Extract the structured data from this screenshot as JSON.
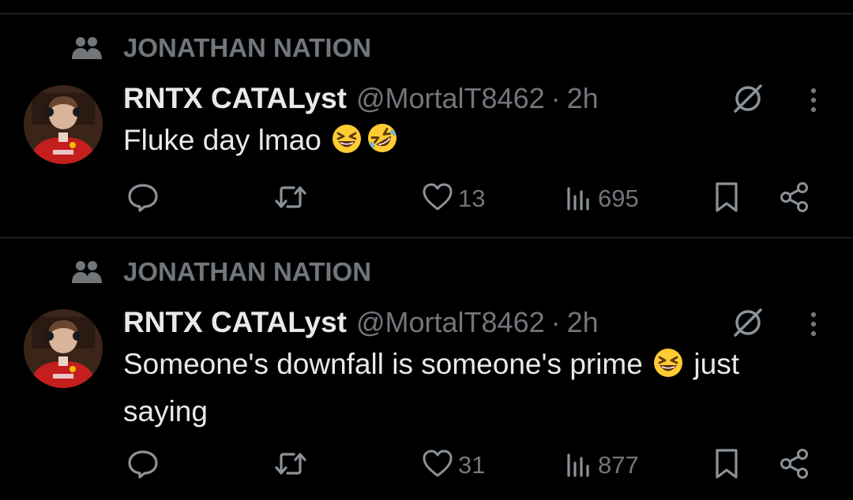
{
  "colors": {
    "background": "#000000",
    "text_primary": "#e7e9ea",
    "text_secondary": "#71767b",
    "divider": "#2f3336"
  },
  "tweets": [
    {
      "community": "JONATHAN NATION",
      "display_name": "RNTX CATALyst",
      "handle": "@MortalT8462",
      "separator": "·",
      "time": "2h",
      "text_parts": [
        "Fluke day lmao "
      ],
      "emojis": [
        "grinning-squinting-face",
        "rolling-on-floor-laughing"
      ],
      "likes": "13",
      "views": "695"
    },
    {
      "community": "JONATHAN NATION",
      "display_name": "RNTX CATALyst",
      "handle": "@MortalT8462",
      "separator": "·",
      "time": "2h",
      "text_parts": [
        "Someone's downfall is someone's prime ",
        " just saying"
      ],
      "emojis": [
        "grinning-squinting-face"
      ],
      "likes": "31",
      "views": "877"
    }
  ],
  "icons": {
    "community": "community-icon",
    "grok": "grok-icon",
    "more": "more-icon",
    "reply": "reply-icon",
    "retweet": "retweet-icon",
    "like": "heart-icon",
    "views": "views-icon",
    "bookmark": "bookmark-icon",
    "share": "share-icon"
  }
}
